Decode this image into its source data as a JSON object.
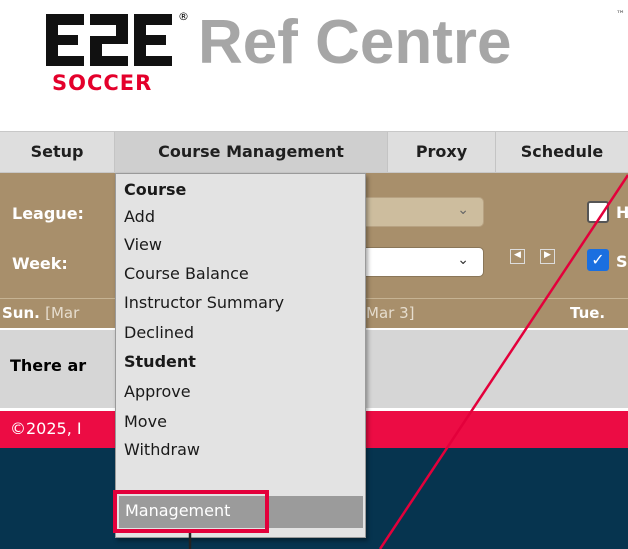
{
  "logo": {
    "mark": "E2E",
    "soccer": "SOCCER",
    "reg": "®",
    "title": "Ref Centre",
    "tm": "™"
  },
  "nav": {
    "items": [
      {
        "label": "Setup"
      },
      {
        "label": "Course Management"
      },
      {
        "label": "Proxy"
      },
      {
        "label": "Schedule"
      }
    ]
  },
  "filters": {
    "league_label": "League:",
    "week_label": "Week:",
    "checkbox1_label": "H",
    "checkbox2_label": "S",
    "checkbox1_checked": false,
    "checkbox2_checked": true,
    "prev_icon": "◀",
    "next_icon": "▶"
  },
  "days": {
    "sun_label": "Sun.",
    "sun_date": "[Mar",
    "mon_date": "Mar 3]",
    "tue_label": "Tue."
  },
  "message": {
    "text": "There ar"
  },
  "footer": {
    "copyright": "©2025, I"
  },
  "dropdown": {
    "items": [
      {
        "label": "Course",
        "header": true
      },
      {
        "label": "Add",
        "header": false
      },
      {
        "label": "View",
        "header": false
      },
      {
        "label": "Course Balance",
        "header": false
      },
      {
        "label": "Instructor Summary",
        "header": false
      },
      {
        "label": "Declined",
        "header": false
      },
      {
        "label": "Student",
        "header": true
      },
      {
        "label": "Approve",
        "header": false
      },
      {
        "label": "Move",
        "header": false
      },
      {
        "label": "Withdraw",
        "header": false
      }
    ],
    "selected": "Management"
  },
  "colors": {
    "accent_red": "#ec0c44",
    "filter_bg": "#a88f6b",
    "footer_dark": "#06344f"
  }
}
